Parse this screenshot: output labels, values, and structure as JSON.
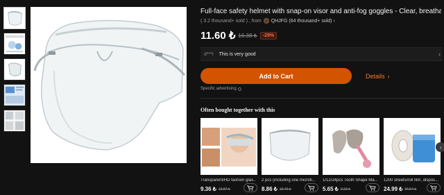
{
  "product": {
    "title": "Full-face safety helmet with snap-on visor and anti-fog goggles - Clear, breathable protection for safe c...",
    "sold": "( 3.2 thousand+ sold ) , from",
    "store": "QHJFG (64 thousand+ sold) ›",
    "price": "11.60 ₺",
    "old_price": "16.38 ₺",
    "discount": "-29%"
  },
  "review": {
    "user": "d***i",
    "text": "This is very good",
    "chevron": "›"
  },
  "actions": {
    "add_to_cart": "Add to Cart",
    "details": "Details",
    "details_chevron": "›",
    "sponsored": "Specific advertising"
  },
  "recommend": {
    "heading": "Often bought together with this",
    "items": [
      {
        "name": "Transparent/HD fashion glas...",
        "price": "9.36 ₺",
        "old_price": "13.87 ₺"
      },
      {
        "name": "2 pcs (including one microfi...",
        "price": "8.86 ₺",
        "old_price": "13.45 ₺"
      },
      {
        "name": "1/12/24pcs Tooth Shape Ma...",
        "price": "5.65 ₺",
        "old_price": "9.19 ₺"
      },
      {
        "name": "1200 sheets/roll film, dispos...",
        "price": "24.99 ₺",
        "old_price": "56.54 ₺"
      }
    ],
    "next": "›"
  },
  "icons": {
    "cart": "cart-icon",
    "info": "info-icon",
    "store": "store-icon",
    "next": "chevron-right-icon"
  },
  "colors": {
    "accent": "#d35400",
    "details": "#f07a2e",
    "discount": "#ff6a3a",
    "background": "#121212"
  }
}
